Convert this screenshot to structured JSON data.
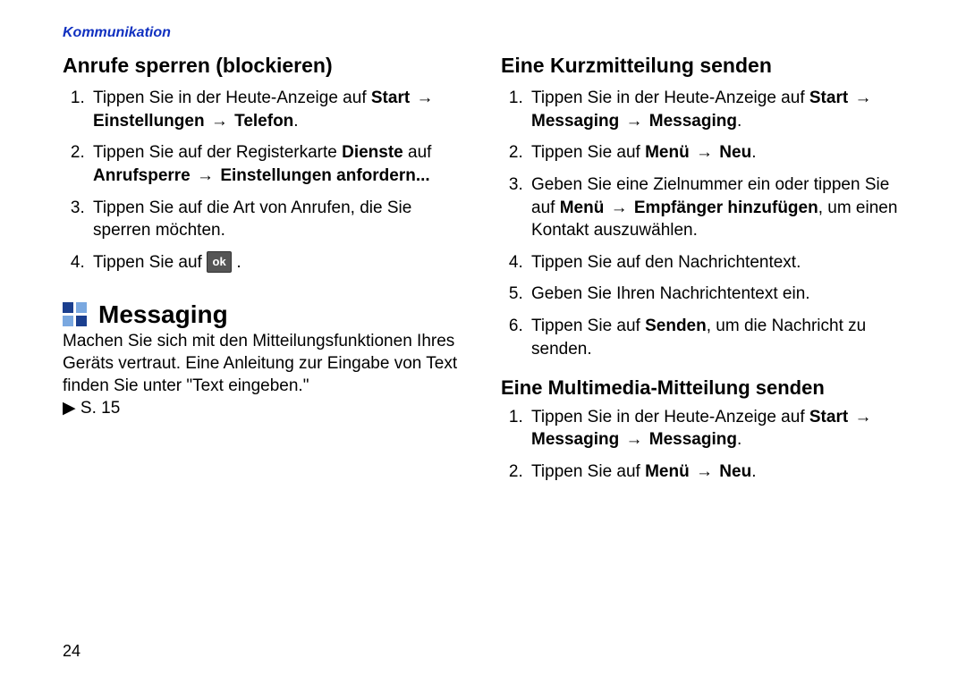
{
  "header": "Kommunikation",
  "pageNumber": "24",
  "arrow": "→",
  "pointer": "▶",
  "okLabel": "ok",
  "left": {
    "h1": "Anrufe sperren (blockieren)",
    "step1_a": "Tippen Sie in der Heute-Anzeige auf ",
    "step1_b1": "Start",
    "step1_b2": "Einstellungen",
    "step1_b3": "Telefon",
    "step1_dot": ".",
    "step2_a": "Tippen Sie auf der Registerkarte ",
    "step2_b1": "Dienste",
    "step2_mid": " auf ",
    "step2_b2": "Anrufsperre",
    "step2_b3": "Einstellungen anfordern...",
    "step3": "Tippen Sie auf die Art von Anrufen, die Sie sperren möchten.",
    "step4_a": "Tippen Sie auf ",
    "step4_dot": ".",
    "sectionTitle": "Messaging",
    "intro_a": "Machen Sie sich mit den Mitteilungsfunktionen Ihres Geräts vertraut. Eine Anleitung zur Eingabe von Text finden Sie unter \"Text eingeben.\" ",
    "intro_ref": " S. 15"
  },
  "right": {
    "h1": "Eine Kurzmitteilung senden",
    "k1_a": "Tippen Sie in der Heute-Anzeige auf ",
    "k1_b1": "Start",
    "k1_b2": "Messaging",
    "k1_b3": "Messaging",
    "k1_dot": ".",
    "k2_a": "Tippen Sie auf ",
    "k2_b1": "Menü",
    "k2_b2": "Neu",
    "k2_dot": ".",
    "k3_a": "Geben Sie eine Zielnummer ein oder tippen Sie auf ",
    "k3_b1": "Menü",
    "k3_b2": "Empfänger hinzufügen",
    "k3_c": ", um einen Kontakt auszuwählen.",
    "k4": "Tippen Sie auf den Nachrichtentext.",
    "k5": "Geben Sie Ihren Nachrichtentext ein.",
    "k6_a": "Tippen Sie auf ",
    "k6_b": "Senden",
    "k6_c": ", um die Nachricht zu senden.",
    "h2": "Eine Multimedia-Mitteilung senden",
    "m1_a": "Tippen Sie in der Heute-Anzeige auf ",
    "m1_b1": "Start",
    "m1_b2": "Messaging",
    "m1_b3": "Messaging",
    "m1_dot": ".",
    "m2_a": "Tippen Sie auf ",
    "m2_b1": "Menü",
    "m2_b2": "Neu",
    "m2_dot": "."
  }
}
